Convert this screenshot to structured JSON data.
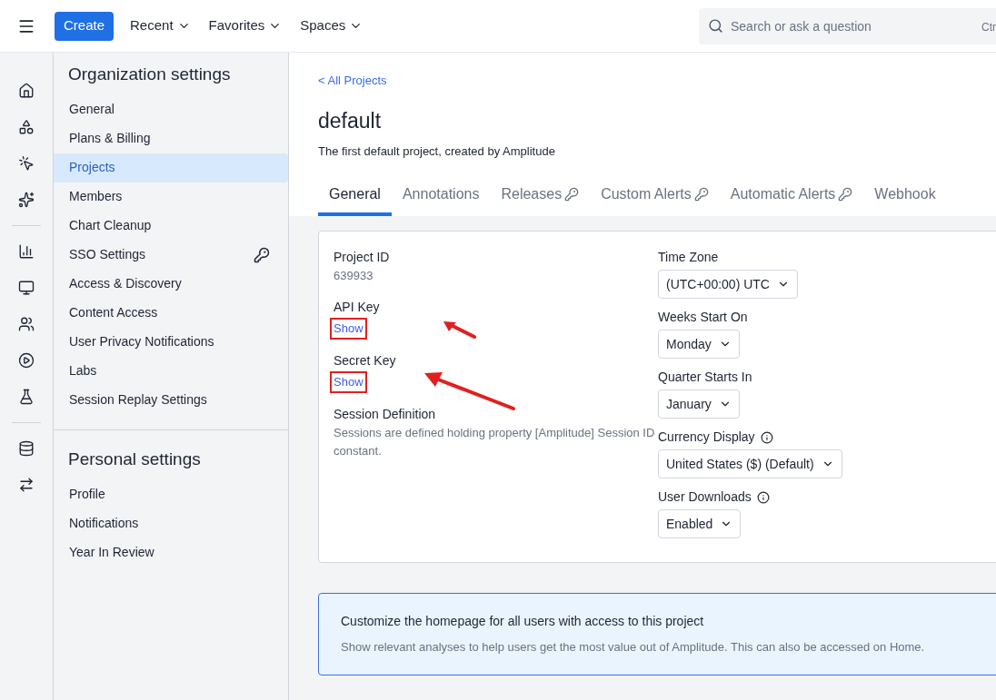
{
  "topbar": {
    "menu": [
      {
        "label": "Recent"
      },
      {
        "label": "Favorites"
      },
      {
        "label": "Spaces"
      }
    ],
    "create": "Create",
    "search": {
      "placeholder": "Search or ask a question",
      "shortcut": "Ctr"
    }
  },
  "sidebar": {
    "sections": [
      {
        "title": "Organization settings",
        "items": [
          {
            "label": "General",
            "selected": false,
            "key": false
          },
          {
            "label": "Plans & Billing",
            "selected": false,
            "key": false
          },
          {
            "label": "Projects",
            "selected": true,
            "key": false
          },
          {
            "label": "Members",
            "selected": false,
            "key": false
          },
          {
            "label": "Chart Cleanup",
            "selected": false,
            "key": false
          },
          {
            "label": "SSO Settings",
            "selected": false,
            "key": true
          },
          {
            "label": "Access & Discovery",
            "selected": false,
            "key": false
          },
          {
            "label": "Content Access",
            "selected": false,
            "key": false
          },
          {
            "label": "User Privacy Notifications",
            "selected": false,
            "key": false
          },
          {
            "label": "Labs",
            "selected": false,
            "key": false
          },
          {
            "label": "Session Replay Settings",
            "selected": false,
            "key": false
          }
        ]
      },
      {
        "title": "Personal settings",
        "items": [
          {
            "label": "Profile",
            "selected": false,
            "key": false
          },
          {
            "label": "Notifications",
            "selected": false,
            "key": false
          },
          {
            "label": "Year In Review",
            "selected": false,
            "key": false
          }
        ]
      }
    ]
  },
  "breadcrumb": "< All Projects",
  "title": "default",
  "subtitle": "The first default project, created by Amplitude",
  "tabs": [
    {
      "label": "General",
      "selected": true,
      "key": false
    },
    {
      "label": "Annotations",
      "selected": false,
      "key": false
    },
    {
      "label": "Releases",
      "selected": false,
      "key": true
    },
    {
      "label": "Custom Alerts",
      "selected": false,
      "key": true
    },
    {
      "label": "Automatic Alerts",
      "selected": false,
      "key": true
    },
    {
      "label": "Webhook",
      "selected": false,
      "key": false
    }
  ],
  "left_fields": [
    {
      "kind": "text",
      "label": "Project ID",
      "value": "639933"
    },
    {
      "kind": "link",
      "label": "API Key",
      "value": "Show",
      "highlighted": true
    },
    {
      "kind": "link",
      "label": "Secret Key",
      "value": "Show",
      "highlighted": true
    },
    {
      "kind": "text",
      "label": "Session Definition",
      "value": "Sessions are defined holding property [Amplitude] Session ID constant."
    }
  ],
  "right_fields": [
    {
      "label": "Time Zone",
      "value": "(UTC+00:00) UTC",
      "info": false
    },
    {
      "label": "Weeks Start On",
      "value": "Monday",
      "info": false
    },
    {
      "label": "Quarter Starts In",
      "value": "January",
      "info": false
    },
    {
      "label": "Currency Display",
      "value": "United States ($) (Default)",
      "info": true
    },
    {
      "label": "User Downloads",
      "value": "Enabled",
      "info": true
    }
  ],
  "banner": {
    "title": "Customize the homepage for all users with access to this project",
    "text": "Show relevant analyses to help users get the most value out of Amplitude. This can also be accessed on Home."
  }
}
